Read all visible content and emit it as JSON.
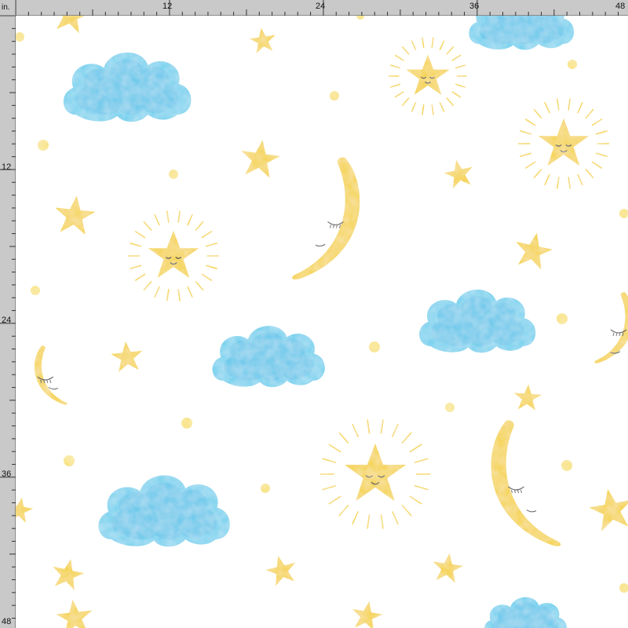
{
  "ruler": {
    "unit": "in.",
    "top_labels": [
      "12",
      "24",
      "36",
      "48"
    ],
    "left_labels": [
      "12",
      "24",
      "36",
      "48"
    ]
  },
  "pattern": {
    "background": "#ffffff",
    "colors": {
      "yellow": "#f5d23b",
      "yellow_light": "#f8e27a",
      "blue": "#6fd0ee",
      "blue_dark": "#3fb6e3",
      "face_line": "#3a3a3a"
    },
    "icons": [
      "cloud-icon",
      "moon-icon",
      "star-icon",
      "sun-star-icon",
      "dot-icon"
    ]
  }
}
